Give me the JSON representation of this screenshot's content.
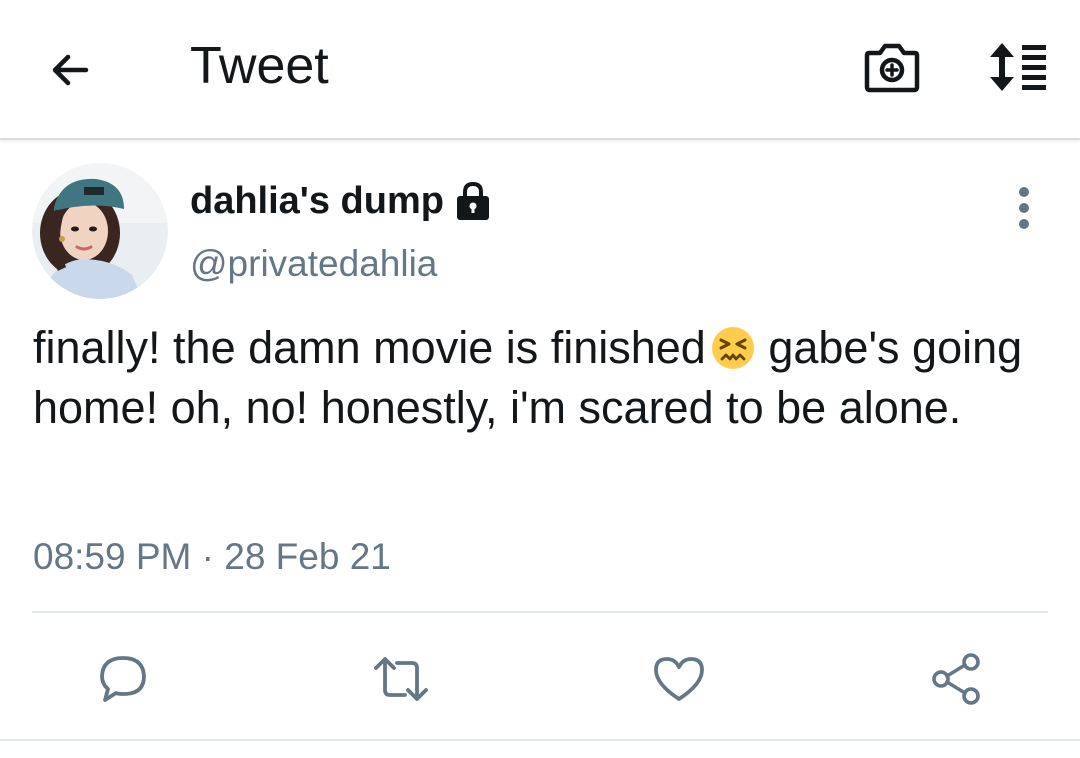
{
  "appbar": {
    "title": "Tweet",
    "icons": [
      "back-arrow-icon",
      "camera-add-icon",
      "sort-lines-icon"
    ]
  },
  "tweet": {
    "display_name": "dahlia's dump",
    "handle": "@privatedahlia",
    "protected_icon": "lock-icon",
    "text": "finally! the damn movie is finished",
    "text_continued": "gabe's going home! oh, no! honestly, i'm scared to be alone.",
    "emoji_icon": "confounded-face-emoji",
    "timestamp": "08:59 PM · 28 Feb 21"
  },
  "actions": [
    {
      "name": "reply",
      "icon": "speech-bubble-icon"
    },
    {
      "name": "retweet",
      "icon": "retweet-arrows-icon"
    },
    {
      "name": "like",
      "icon": "heart-icon"
    },
    {
      "name": "share",
      "icon": "share-nodes-icon"
    }
  ],
  "colors": {
    "text_primary": "#14171a",
    "text_secondary": "#657786",
    "icon_gray": "#657786",
    "divider": "#e1e8ed"
  }
}
